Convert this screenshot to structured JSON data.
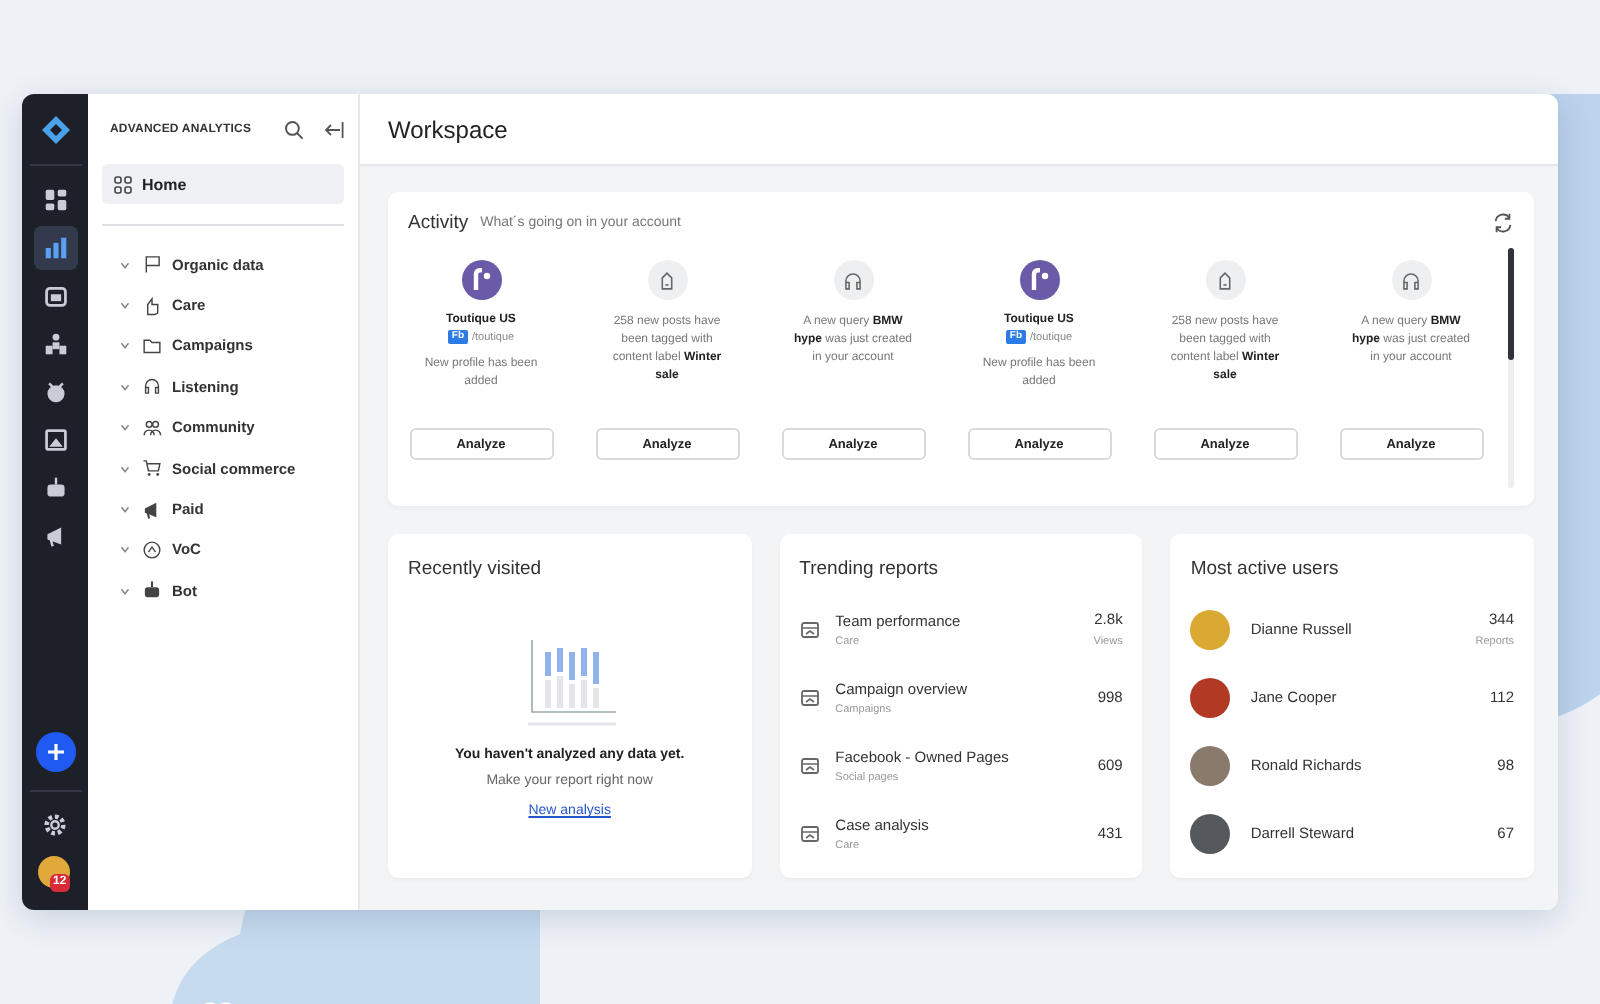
{
  "rail": {
    "items": [
      {
        "selected": false
      },
      {
        "selected": true
      },
      {
        "selected": false
      },
      {
        "selected": false
      },
      {
        "selected": false
      },
      {
        "selected": false
      },
      {
        "selected": false
      },
      {
        "selected": false
      }
    ],
    "notification_count": "12"
  },
  "nav": {
    "title": "ADVANCED ANALYTICS",
    "home": {
      "label": "Home",
      "selected": true
    },
    "items": [
      {
        "label": "Organic data",
        "expanded": false
      },
      {
        "label": "Care",
        "expanded": false
      },
      {
        "label": "Campaigns",
        "expanded": false
      },
      {
        "label": "Listening",
        "expanded": false
      },
      {
        "label": "Community",
        "expanded": false
      },
      {
        "label": "Social commerce",
        "expanded": false
      },
      {
        "label": "Paid",
        "expanded": false
      },
      {
        "label": "VoC",
        "expanded": false
      },
      {
        "label": "Bot",
        "expanded": false
      }
    ]
  },
  "page_title": "Workspace",
  "activity": {
    "title": "Activity",
    "subtitle": "What´s going on in your account",
    "items": [
      {
        "kind": "profile",
        "name": "Toutique US",
        "network": "Fb",
        "handle": "/toutique",
        "text": "New profile has been added",
        "button": "Analyze"
      },
      {
        "kind": "tag",
        "text": "258 new posts have been tagged with content label **Winter sale**",
        "button": "Analyze"
      },
      {
        "kind": "query",
        "text": "A new query **BMW hype** was just created in your account",
        "button": "Analyze"
      },
      {
        "kind": "profile",
        "name": "Toutique US",
        "network": "Fb",
        "handle": "/toutique",
        "text": "New profile has been added",
        "button": "Analyze"
      },
      {
        "kind": "tag",
        "text": "258 new posts have been tagged with content label **Winter sale**",
        "button": "Analyze"
      },
      {
        "kind": "query",
        "text": "A new query **BMW hype** was just created in your account",
        "button": "Analyze"
      }
    ]
  },
  "recently_visited": {
    "title": "Recently visited",
    "empty_title": "You haven't analyzed any data yet.",
    "empty_text": "Make your report right now",
    "link": "New analysis"
  },
  "trending_reports": {
    "title": "Trending reports",
    "rows": [
      {
        "name": "Team performance",
        "category": "Care",
        "value": "2.8k",
        "unit": "Views"
      },
      {
        "name": "Campaign overview",
        "category": "Campaigns",
        "value": "998"
      },
      {
        "name": "Facebook - Owned Pages",
        "category": "Social pages",
        "value": "609"
      },
      {
        "name": "Case analysis",
        "category": "Care",
        "value": "431"
      }
    ]
  },
  "active_users": {
    "title": "Most active users",
    "rows": [
      {
        "name": "Dianne Russell",
        "value": "344",
        "unit": "Reports"
      },
      {
        "name": "Jane Cooper",
        "value": "112"
      },
      {
        "name": "Ronald Richards",
        "value": "98"
      },
      {
        "name": "Darrell Steward",
        "value": "67"
      }
    ]
  }
}
